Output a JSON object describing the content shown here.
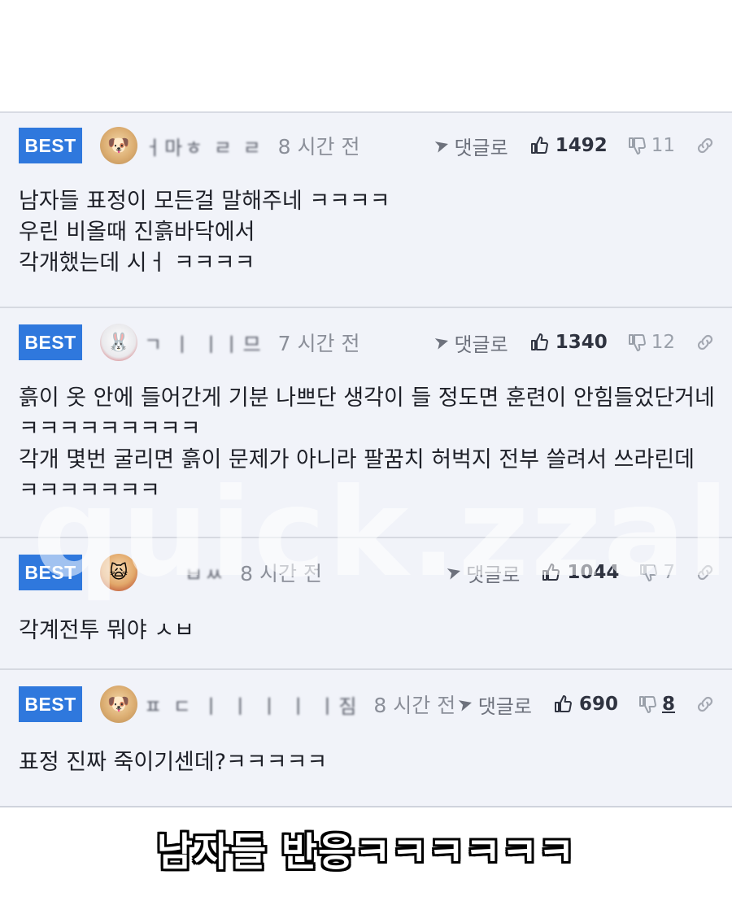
{
  "watermark": "quick.zzal",
  "reply_label": "댓글로",
  "badge": "BEST",
  "comments": [
    {
      "nickname": "ㅓ마ㅎ ㄹ ㄹ",
      "time": "8 시간 전",
      "likes": "1492",
      "dislikes": "11",
      "text": "남자들 표정이 모든걸 말해주네 ㅋㅋㅋㅋ\n우린 비올때 진흙바닥에서\n각개했는데 시ㅓ ㅋㅋㅋㅋ"
    },
    {
      "nickname": "ㄱ ㅣ ㅣㅣ므",
      "time": "7 시간 전",
      "likes": "1340",
      "dislikes": "12",
      "text": "흙이 옷 안에 들어간게 기분 나쁘단 생각이 들 정도면 훈련이 안힘들었단거네 ㅋㅋㅋㅋㅋㅋㅋㅋㅋ\n각개 몇번 굴리면 흙이 문제가 아니라 팔꿈치 허벅지 전부 쓸려서 쓰라린데 ㅋㅋㅋㅋㅋㅋㅋ"
    },
    {
      "nickname": "ㅂㅆ",
      "time": "8 시간 전",
      "likes": "1044",
      "dislikes": "7",
      "text": "각계전투 뭐야 ㅅㅂ"
    },
    {
      "nickname": "ㅍ ㄷ ㅣ ㅣ ㅣ ㅣ ㅣ짐",
      "time": "8 시간 전",
      "likes": "690",
      "dislikes": "8",
      "text": "표정 진짜 죽이기센데?ㅋㅋㅋㅋㅋ"
    }
  ],
  "caption": "남자들 반응ㅋㅋㅋㅋㅋㅋ"
}
